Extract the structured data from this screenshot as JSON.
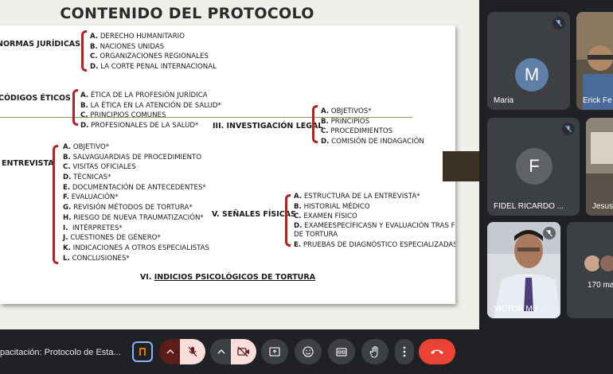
{
  "slide": {
    "title": "CONTENIDO DEL PROTOCOLO",
    "sections": {
      "normas": {
        "label": "NORMAS JURÍDICAS",
        "items": [
          {
            "letter": "A.",
            "text": "DERECHO HUMANITARIO"
          },
          {
            "letter": "B.",
            "text": "NACIONES UNIDAS"
          },
          {
            "letter": "C.",
            "text": "ORGANIZACIONES REGIONALES"
          },
          {
            "letter": "D.",
            "text": "LA CORTE PENAL INTERNACIONAL"
          }
        ]
      },
      "codigos": {
        "label": "CÓDIGOS ÉTICOS",
        "items": [
          {
            "letter": "A.",
            "text": "ÉTICA DE LA PROFESIÓN JURÍDICA"
          },
          {
            "letter": "B.",
            "text": "LA ÉTICA EN LA ATENCIÓN DE SALUD*"
          },
          {
            "letter": "C.",
            "text": "PRINCIPIOS COMUNES"
          },
          {
            "letter": "D.",
            "text": "PROFESIONALES DE LA SALUD*"
          }
        ]
      },
      "investigacion": {
        "label": "III. INVESTIGACIÓN LEGAL",
        "items": [
          {
            "letter": "A.",
            "text": "OBJETIVOS*"
          },
          {
            "letter": "B.",
            "text": "PRINCIPIOS"
          },
          {
            "letter": "C.",
            "text": "PROCEDIMIENTOS"
          },
          {
            "letter": "D.",
            "text": "COMISIÓN DE INDAGACIÓN"
          }
        ]
      },
      "entrevista": {
        "label": "ENTREVISTA",
        "items": [
          {
            "letter": "A.",
            "text": "OBJETIVO*"
          },
          {
            "letter": "B.",
            "text": "SALVAGUARDIAS DE PROCEDIMIENTO"
          },
          {
            "letter": "C.",
            "text": "VISITAS OFICIALES"
          },
          {
            "letter": "D.",
            "text": "TÉCNICAS*"
          },
          {
            "letter": "E.",
            "text": "DOCUMENTACIÓN DE ANTECEDENTES*"
          },
          {
            "letter": "F.",
            "text": "EVALUACIÓN*"
          },
          {
            "letter": "G.",
            "text": "REVISIÓN MÉTODOS DE TORTURA*"
          },
          {
            "letter": "H.",
            "text": "RIESGO DE NUEVA TRAUMATIZACIÓN*"
          },
          {
            "letter": "I.",
            "text": "INTÉRPRETES*"
          },
          {
            "letter": "J.",
            "text": "CUESTIONES DE GÉNERO*"
          },
          {
            "letter": "K.",
            "text": "INDICACIONES A OTROS ESPECIALISTAS"
          },
          {
            "letter": "L.",
            "text": "CONCLUSIONES*"
          }
        ]
      },
      "senales": {
        "label": "V. SEÑALES FÍSICAS",
        "items": [
          {
            "letter": "A.",
            "text": "ESTRUCTURA DE LA ENTREVISTA*"
          },
          {
            "letter": "B.",
            "text": "HISTORIAL MÉDICO"
          },
          {
            "letter": "C.",
            "text": "EXAMEN FÍSICO"
          },
          {
            "letter": "D.",
            "text": "EXAMEESPECÍFICASN Y EVALUACIÓN TRAS FORMAS DE TORTURA"
          },
          {
            "letter": "E.",
            "text": "PRUEBAS DE DIAGNÓSTICO ESPECIALIZADAS"
          }
        ]
      },
      "indicios": {
        "number": "VI.",
        "label": "INDICIOS PSICOLÓGICOS DE TORTURA"
      }
    }
  },
  "participants": [
    {
      "name": "Maria",
      "initial": "M",
      "avatar_color": "#5f7fa8",
      "muted": true
    },
    {
      "name": "Erick Fe",
      "muted": false
    },
    {
      "name": "FIDEL RICARDO ...",
      "initial": "F",
      "avatar_color": "#5f6368",
      "muted": true
    },
    {
      "name": "Jesus",
      "muted": false
    },
    {
      "name": "VICTOR MU...",
      "muted": true
    },
    {
      "name": "170 ma",
      "muted": false
    }
  ],
  "toolbar": {
    "meeting_name": "pacitación: Protocolo de Esta...",
    "buttons": [
      "hand-raise-icon",
      "chevron-up-icon",
      "mic-off-icon",
      "chevron-up-icon",
      "camera-off-icon",
      "present-icon",
      "emoji-icon",
      "captions-icon",
      "raise-hand-icon",
      "more-icon",
      "end-call-icon"
    ]
  },
  "colors": {
    "bracket": "#b52226",
    "end_call": "#ea4335",
    "muted_bg": "#f9dedc"
  }
}
